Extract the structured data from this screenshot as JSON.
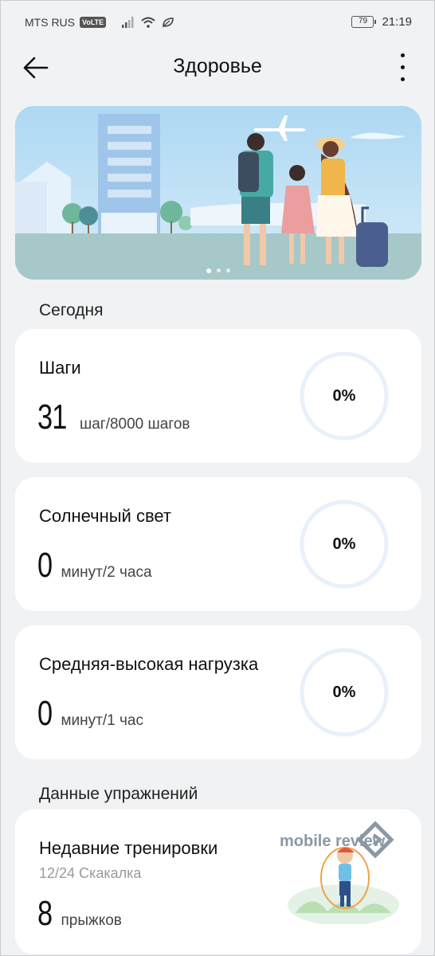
{
  "status_bar": {
    "carrier": "MTS RUS",
    "volte": "VoLTE",
    "battery": "79",
    "time": "21:19"
  },
  "header": {
    "title": "Здоровье"
  },
  "banner": {
    "slides_total": 3,
    "active_slide": 1
  },
  "today": {
    "section_label": "Сегодня",
    "cards": [
      {
        "title": "Шаги",
        "value": "31",
        "unit": "шаг/8000 шагов",
        "percent_label": "0%",
        "progress": 0
      },
      {
        "title": "Солнечный свет",
        "value": "0",
        "unit": "минут/2 часа",
        "percent_label": "0%",
        "progress": 0
      },
      {
        "title": "Средняя-высокая нагрузка",
        "value": "0",
        "unit": "минут/1 час",
        "percent_label": "0%",
        "progress": 0
      }
    ]
  },
  "exercise": {
    "section_label": "Данные упражнений",
    "recent": {
      "title": "Недавние тренировки",
      "subtitle": "12/24 Скакалка",
      "value": "8",
      "unit": "прыжков",
      "watermark": "mobile review"
    }
  },
  "colors": {
    "background": "#f1f2f4",
    "card": "#ffffff",
    "ring_track": "#e8f0fb",
    "ring_progress": "#2e7cf6"
  }
}
